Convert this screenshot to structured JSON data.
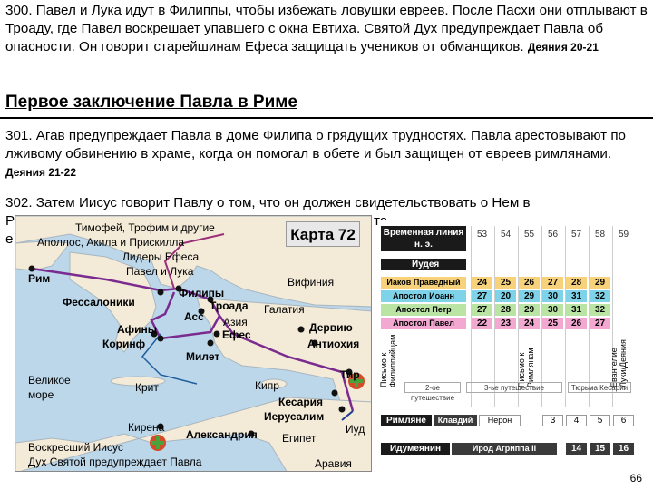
{
  "p300": {
    "text": "300. Павел и Лука идут в Филиппы, чтобы избежать ловушки евреев. После Пасхи они отплывают в Троаду, где Павел воскрешает упавшего с окна Евтиха. Святой Дух предупреждает Павла об опасности. Он говорит старейшинам Ефеса защищать учеников от обманщиков.",
    "ref": "Деяния 20-21"
  },
  "heading": "Первое заключение Павла в Риме",
  "p301": {
    "text": "301. Агав предупреждает Павла в доме Филипа о грядущих трудностях. Павла арестовывают по лживому обвинению в храме, когда он помогал в обете и был защищен от евреев римлянами.",
    "ref": "Деяния 21-22"
  },
  "p302": {
    "line1": "302. Затем Иисус говорит Павлу о том, что он должен свидетельствовать о Нем в",
    "line2_start": "Р",
    "line2_end": "то",
    "line3_start": "е"
  },
  "map": {
    "title": "Карта 72",
    "labels": {
      "timothy": "Тимофей, Трофим и другие",
      "apollos": "Аполлос, Акила и Прискилла",
      "elders": "Лидеры Ефеса",
      "paul_luke": "Павел и Лука",
      "rome": "Рим",
      "philippi": "Филипы",
      "bithynia": "Вифиния",
      "thessalonica": "Фессалоники",
      "troas": "Троада",
      "galatia": "Галатия",
      "assos": "Асс",
      "asia": "Азия",
      "athens": "Афины",
      "ephesus": "Ефес",
      "derbe": "Дервию",
      "corinth": "Коринф",
      "antioch": "Антиохия",
      "miletus": "Милет",
      "great_sea_1": "Великое",
      "great_sea_2": "море",
      "crete": "Крит",
      "cyprus": "Кипр",
      "tyre": "Тир",
      "caesarea": "Кесария",
      "jerusalem": "Иерусалим",
      "judea": "Иуд",
      "cyrene": "Кирена",
      "alexandria": "Александрия",
      "egypt": "Египет",
      "risen_jesus": "Воскресший Иисус",
      "holy_spirit": "Дух Святой предупреждает Павла",
      "arabia": "Аравия"
    }
  },
  "timeline": {
    "header_line1": "Временная линия",
    "header_line2": "н. э.",
    "years": [
      "53",
      "54",
      "55",
      "56",
      "57",
      "58",
      "59"
    ],
    "judea": "Иудея",
    "rows": [
      {
        "label": "Иаков Праведный",
        "color": "#f7d27a",
        "cells": [
          "24",
          "25",
          "26",
          "27",
          "28",
          "29"
        ]
      },
      {
        "label": "Апостол Иоанн",
        "color": "#7fd3e8",
        "cells": [
          "27",
          "20",
          "29",
          "30",
          "31",
          "32"
        ]
      },
      {
        "label": "Апостол Петр",
        "color": "#b9e4a4",
        "cells": [
          "27",
          "28",
          "29",
          "30",
          "31",
          "32"
        ]
      },
      {
        "label": "Апостол Павел",
        "color": "#f3a8d2",
        "cells": [
          "22",
          "23",
          "24",
          "25",
          "26",
          "27"
        ]
      }
    ],
    "letters": {
      "philippians": "Письмо к Филиппийцам",
      "romans": "Письмо к Римлянам",
      "gospels": "Евангелие Луки/Деяния"
    },
    "journey2": "2-ое путешествие",
    "journey3": "3-ье путешествие",
    "prison": "Тюрьма Кесарии",
    "romans_row": {
      "label": "Римляне",
      "ruler1": "Клавдий",
      "ruler2": "Нерон",
      "cells": [
        "3",
        "4",
        "5",
        "6"
      ]
    },
    "idumeans_row": {
      "label": "Идумеянин",
      "ruler": "Ирод Агриппа II",
      "cells": [
        "14",
        "15",
        "16"
      ]
    }
  },
  "page_number": "66"
}
